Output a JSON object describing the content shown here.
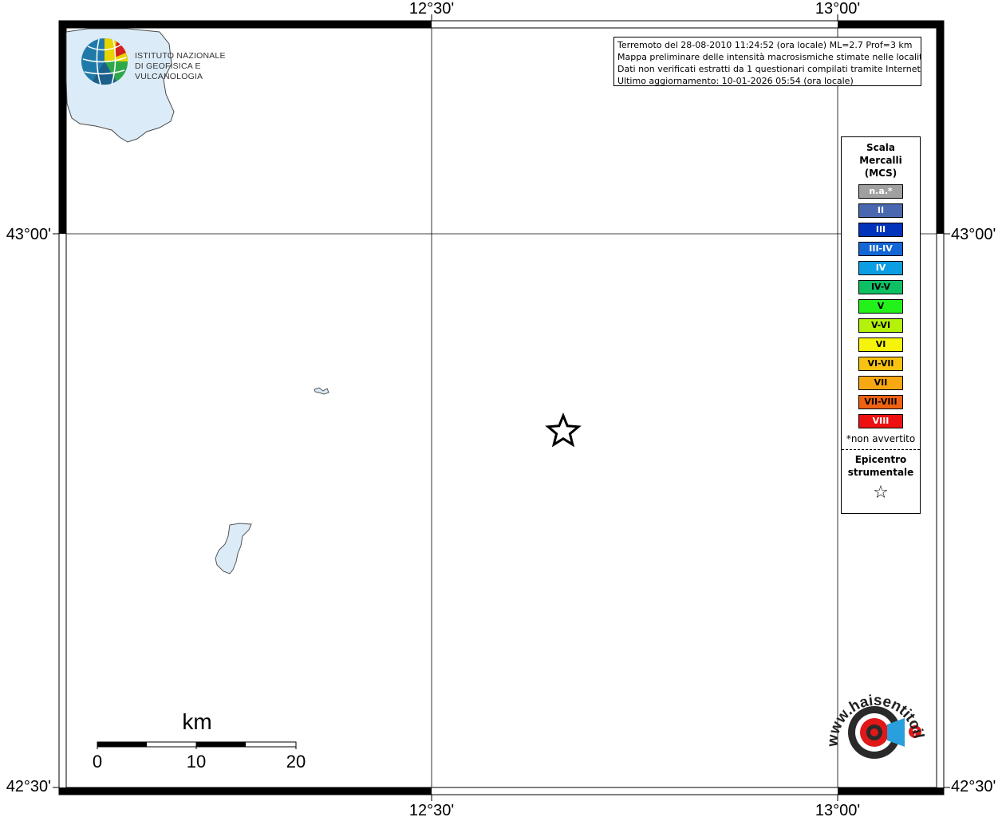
{
  "map": {
    "coords": {
      "top_lon_1": "12°30'",
      "top_lon_2": "13°00'",
      "bottom_lon_1": "12°30'",
      "bottom_lon_2": "13°00'",
      "left_lat_1": "43°00'",
      "left_lat_2": "42°30'",
      "right_lat_1": "43°00'",
      "right_lat_2": "42°30'"
    },
    "water_color": "#dbebf7",
    "epicenter_symbol": "star"
  },
  "info": {
    "line1": "Terremoto del 28-08-2010 11:24:52 (ora locale) ML=2.7 Prof=3 km",
    "line2": "Mappa preliminare delle intensità macrosismiche stimate nelle località",
    "line3": "Dati non verificati estratti da 1 questionari compilati tramite Internet.",
    "line4": "Ultimo aggiornamento: 10-01-2026 05:54 (ora locale)"
  },
  "legend": {
    "title_line1": "Scala",
    "title_line2": "Mercalli",
    "title_line3": "(MCS)",
    "items": [
      {
        "label": "n.a.*",
        "color": "#a0a0a0",
        "text_color": "#ffffff"
      },
      {
        "label": "II",
        "color": "#4a68b0",
        "text_color": "#ffffff"
      },
      {
        "label": "III",
        "color": "#0033bb",
        "text_color": "#ffffff"
      },
      {
        "label": "III-IV",
        "color": "#1266d6",
        "text_color": "#ffffff"
      },
      {
        "label": "IV",
        "color": "#0b9ee2",
        "text_color": "#ffffff"
      },
      {
        "label": "IV-V",
        "color": "#0ec064",
        "text_color": "#000000"
      },
      {
        "label": "V",
        "color": "#22f21a",
        "text_color": "#000000"
      },
      {
        "label": "V-VI",
        "color": "#b4f20c",
        "text_color": "#000000"
      },
      {
        "label": "VI",
        "color": "#f6f40a",
        "text_color": "#000000"
      },
      {
        "label": "VI-VII",
        "color": "#f8c210",
        "text_color": "#000000"
      },
      {
        "label": "VII",
        "color": "#f8a812",
        "text_color": "#000000"
      },
      {
        "label": "VII-VIII",
        "color": "#f06212",
        "text_color": "#000000"
      },
      {
        "label": "VIII",
        "color": "#ee1010",
        "text_color": "#ffffff"
      }
    ],
    "note": "*non avvertito",
    "epi_line1": "Epicentro",
    "epi_line2": "strumentale",
    "epi_symbol": "☆"
  },
  "scalebar": {
    "title": "km",
    "ticks": [
      "0",
      "10",
      "20"
    ]
  },
  "logos": {
    "ingv_line1": "ISTITUTO NAZIONALE",
    "ingv_line2": "DI GEOFISICA E VULCANOLOGIA",
    "hsi_text": "www.haisentitoilterremoto.it"
  }
}
